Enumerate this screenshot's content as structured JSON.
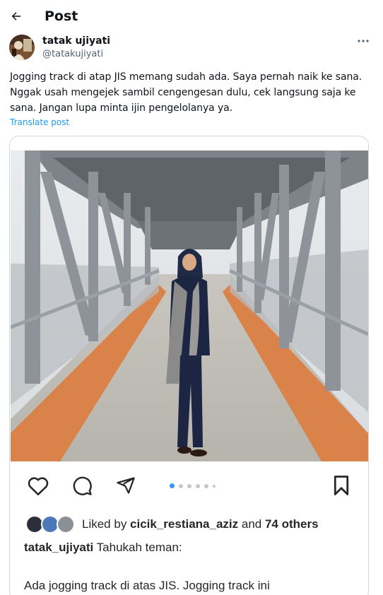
{
  "header": {
    "title": "Post",
    "back_icon": "arrow-left-icon"
  },
  "author": {
    "display_name": "tatak ujiyati",
    "handle": "@tatakujiyati",
    "more_icon": "more-horizontal-icon"
  },
  "tweet": {
    "lines": [
      "Jogging track di atap JIS memang sudah ada. Saya pernah naik ke sana.",
      "Nggak usah mengejek sambil cengengesan dulu, cek langsung saja ke",
      "sana. Jangan lupa minta ijin pengelolanya ya."
    ],
    "translate_label": "Translate post"
  },
  "instagram": {
    "icons": [
      "heart-icon",
      "comment-icon",
      "share-icon",
      "bookmark-icon"
    ],
    "carousel": {
      "total": 6,
      "active": 1
    },
    "liked_by_prefix": "Liked by ",
    "liked_by_user": "cicik_restiana_aziz",
    "liked_by_and": " and ",
    "liked_by_others": "74 others",
    "caption_user": "tatak_ujiyati",
    "caption_text": " Tahukah teman:",
    "caption_line2": "Ada jogging track di atas JIS.  Jogging track ini"
  },
  "colors": {
    "accent": "#1d9bf0",
    "muted": "#536471",
    "ig_active_dot": "#3897f0",
    "track_orange": "#d9824a"
  }
}
